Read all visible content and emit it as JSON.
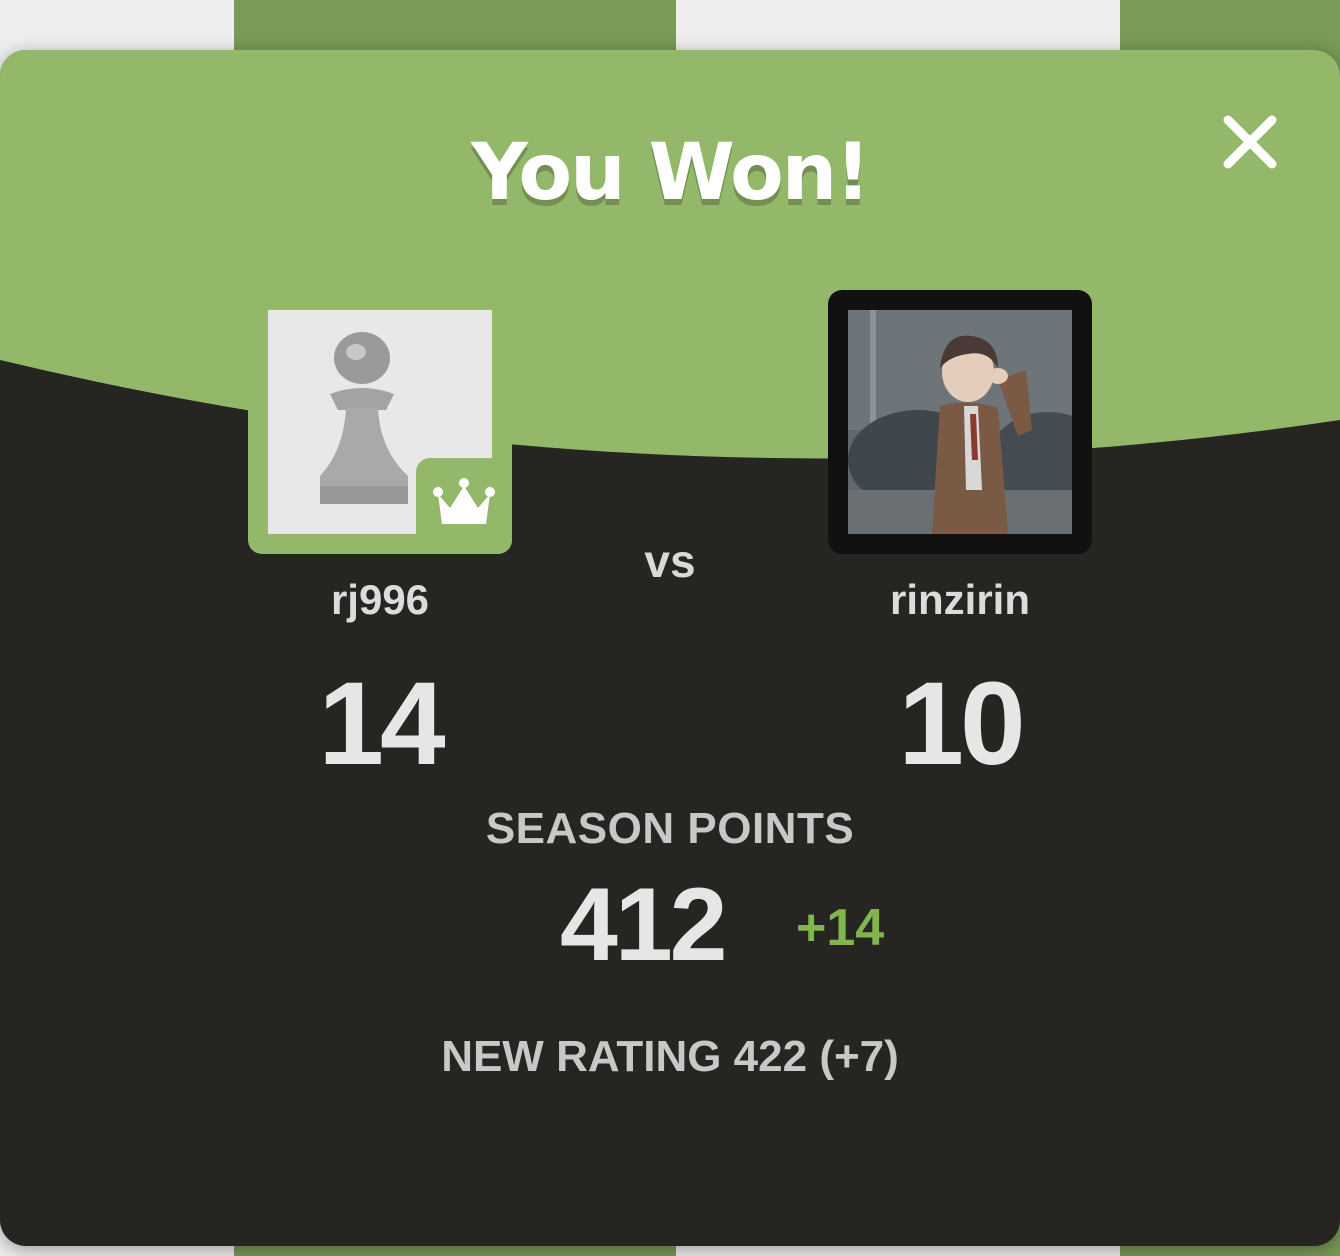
{
  "colors": {
    "header_green": "#94b869",
    "panel_dark": "#262522",
    "accent_green": "#81b64c",
    "text_light": "#e6e6e6"
  },
  "result": {
    "title": "You Won!",
    "close_icon": "close-icon"
  },
  "players": {
    "me": {
      "username": "rj996",
      "score": "14",
      "avatar_icon": "pawn-icon",
      "badge_icon": "crown-icon"
    },
    "opponent": {
      "username": "rinzirin",
      "score": "10",
      "avatar_icon": "profile-photo"
    },
    "vs_label": "vs"
  },
  "season": {
    "label": "SEASON POINTS",
    "points": "412",
    "delta": "+14"
  },
  "rating": {
    "text": "NEW RATING 422 (+7)"
  }
}
